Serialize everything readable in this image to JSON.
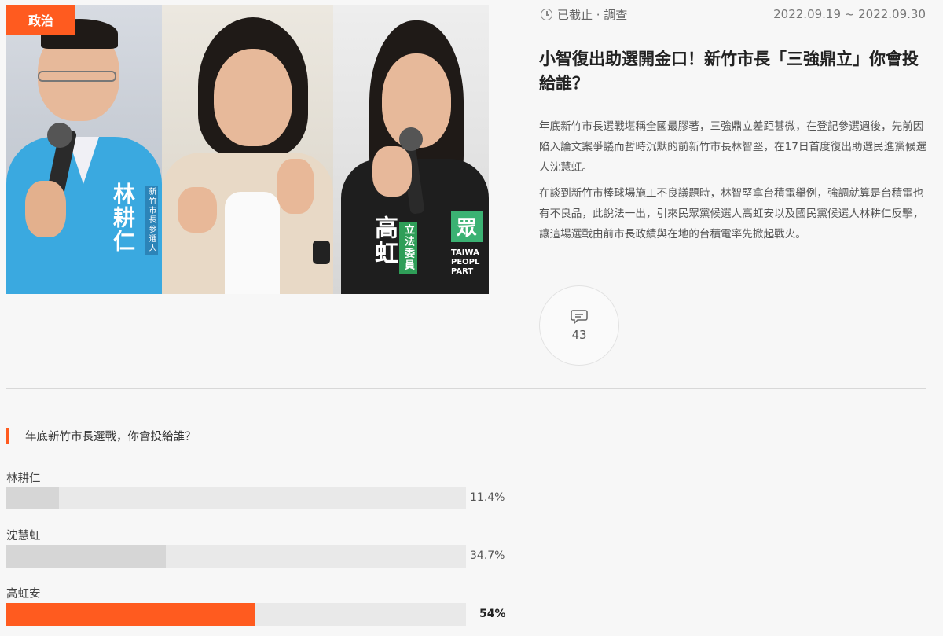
{
  "category_badge": "政治",
  "status": {
    "label": "已截止 · 調查",
    "icon": "clock-icon"
  },
  "date_range": "2022.09.19 ~ 2022.09.30",
  "article": {
    "title": "小智復出助選開金口！新竹市長「三強鼎立」你會投給誰？",
    "paragraphs": [
      "年底新竹市長選戰堪稱全國最膠著，三強鼎立差距甚微，在登記參選週後，先前因陷入論文案爭議而暫時沉默的前新竹市長林智堅，在17日首度復出助選民進黨候選人沈慧虹。",
      "在談到新竹市棒球場施工不良議題時，林智堅拿台積電舉例，強調就算是台積電也有不良品，此說法一出，引來民眾黨候選人高虹安以及國民黨候選人林耕仁反擊，讓這場選戰由前市長政績與在地的台積電率先掀起戰火。"
    ]
  },
  "comments": {
    "icon": "comment-icon",
    "count": "43"
  },
  "hero_image": {
    "vest_text_left": "林耕仁",
    "vest_small_left": "新竹市長參選人",
    "vest_text_right": "高虹",
    "vest_small_right": "立法委員",
    "party_right": "眾",
    "party_right_en": "TAIWA PEOPL PART"
  },
  "poll": {
    "question": "年底新竹市長選戰，你會投給誰？",
    "options": [
      {
        "label": "林耕仁",
        "percent_text": "11.4%",
        "percent": 11.4,
        "winner": false
      },
      {
        "label": "沈慧虹",
        "percent_text": "34.7%",
        "percent": 34.7,
        "winner": false
      },
      {
        "label": "高虹安",
        "percent_text": "54%",
        "percent": 54,
        "winner": true
      }
    ]
  },
  "colors": {
    "accent": "#ff5b1f",
    "bar_track": "#e9e9e9",
    "bar_fill": "#d6d6d6"
  }
}
